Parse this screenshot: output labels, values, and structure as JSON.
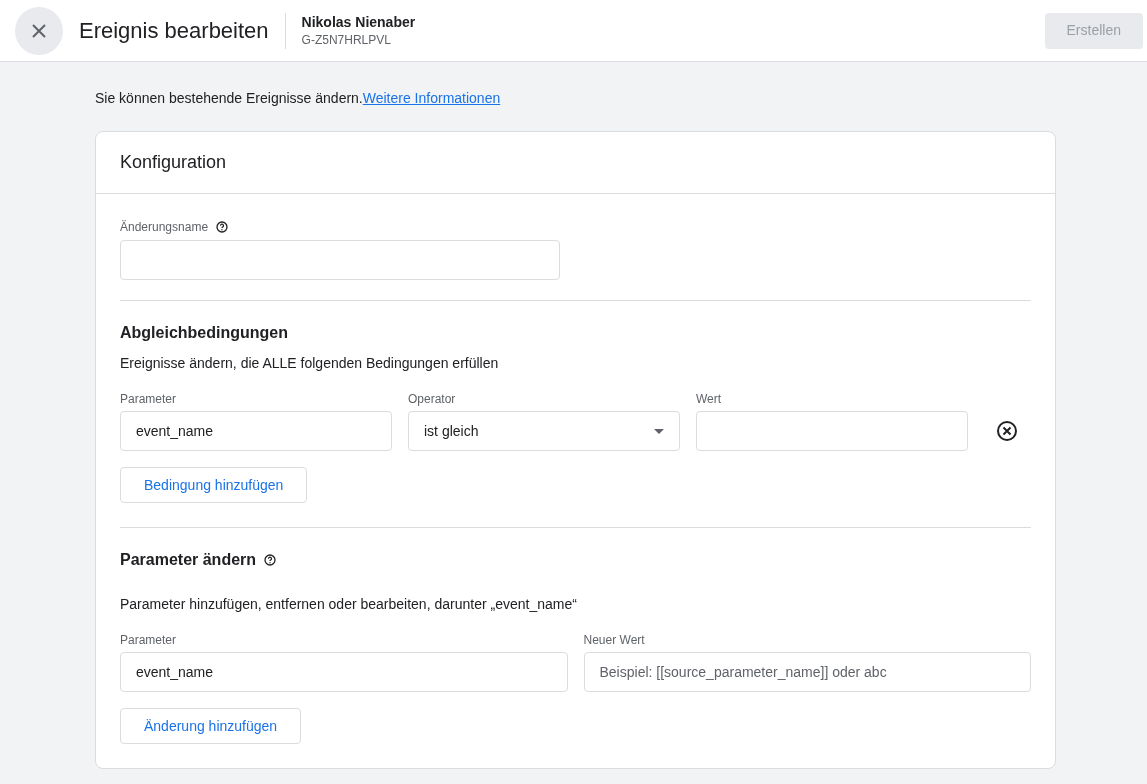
{
  "header": {
    "title": "Ereignis bearbeiten",
    "account_name": "Nikolas Nienaber",
    "property_id": "G-Z5N7HRLPVL",
    "create_button": {
      "label": "Erstellen",
      "disabled": true
    }
  },
  "intro": {
    "text": "Sie können bestehende Ereignisse ändern.",
    "link": "Weitere Informationen"
  },
  "card": {
    "title": "Konfiguration",
    "name_field": {
      "label": "Änderungsname"
    },
    "conditions": {
      "heading": "Abgleichbedingungen",
      "description": "Ereignisse ändern, die ALLE folgenden Bedingungen erfüllen",
      "rows": [
        {
          "parameter": {
            "label": "Parameter",
            "value": "event_name"
          },
          "operator": {
            "label": "Operator",
            "value": "ist gleich"
          },
          "value": {
            "label": "Wert"
          }
        }
      ],
      "add_button": "Bedingung hinzufügen"
    },
    "parameters": {
      "heading": "Parameter ändern",
      "description": "Parameter hinzufügen, entfernen oder bearbeiten, darunter „event_name“",
      "rows": [
        {
          "parameter": {
            "label": "Parameter",
            "value": "event_name"
          },
          "new_value": {
            "label": "Neuer Wert",
            "placeholder": "Beispiel: [[source_parameter_name]] oder abc"
          }
        }
      ],
      "add_button": "Änderung hinzufügen"
    }
  }
}
